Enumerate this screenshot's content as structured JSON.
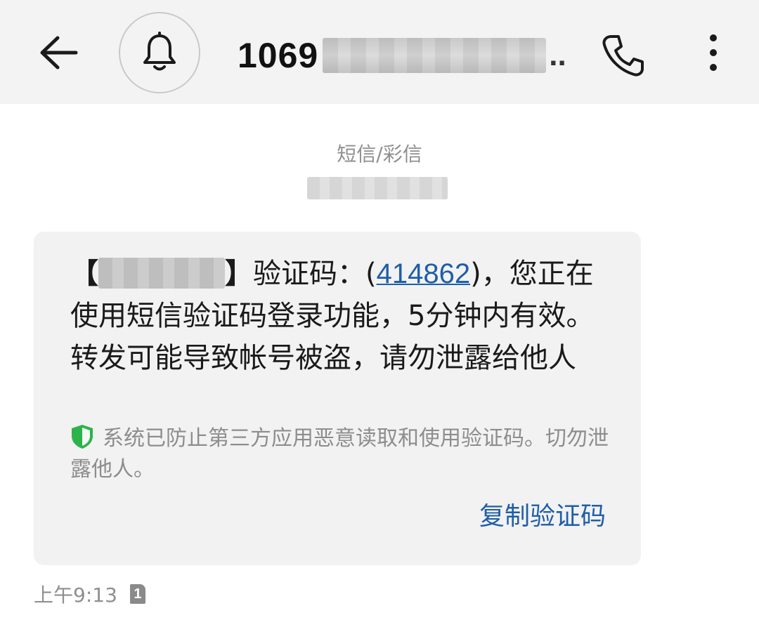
{
  "header": {
    "back_icon": "arrow-left-icon",
    "bell_icon": "bell-icon",
    "sender_number_prefix": "1069",
    "sender_number_ellipsis": "..",
    "phone_icon": "phone-icon",
    "more_icon": "more-vertical-icon"
  },
  "thread": {
    "message_type": "短信/彩信"
  },
  "message": {
    "bracket_open": "【",
    "bracket_close": "】",
    "code_label": "验证码：(",
    "code": "414862",
    "text_after_code": ")，您正在使用短信验证码登录功能，5分钟内有效。转发可能导致帐号被盗，请勿泄露给他人",
    "security_note": "系统已防止第三方应用恶意读取和使用验证码。切勿泄露他人。",
    "copy_code_label": "复制验证码",
    "time": "上午9:13",
    "sim_slot": "1"
  },
  "colors": {
    "header_bg": "#f3f3f3",
    "bubble_bg": "#f2f2f2",
    "link": "#1f5ea8",
    "shield": "#2cb34a",
    "muted_text": "#8f8f8f"
  }
}
